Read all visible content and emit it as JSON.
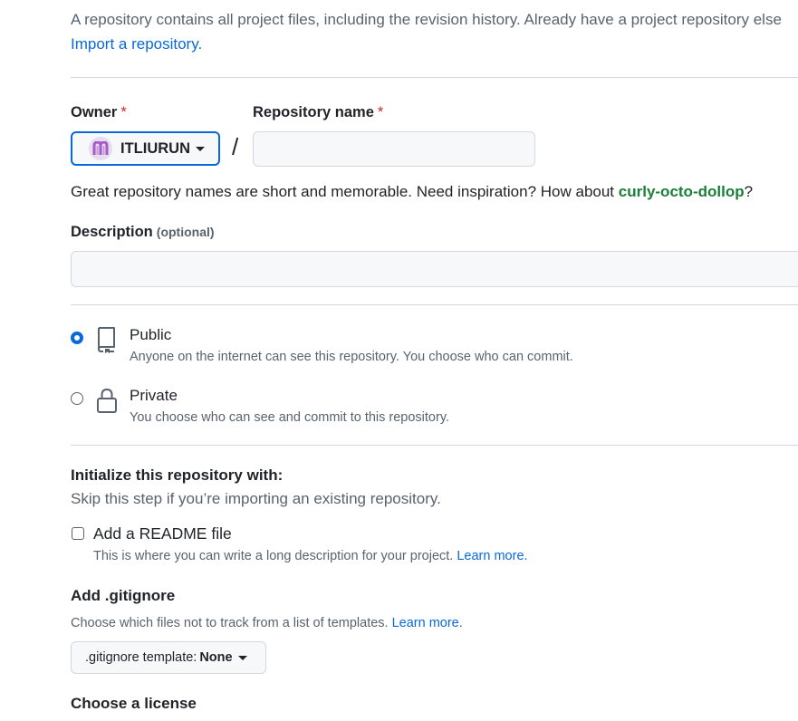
{
  "intro": {
    "text": "A repository contains all project files, including the revision history. Already have a project repository else",
    "import_link": "Import a repository."
  },
  "owner": {
    "label": "Owner",
    "required_mark": "*",
    "value": "ITLIURUN"
  },
  "repo_name": {
    "label": "Repository name",
    "required_mark": "*",
    "value": "",
    "placeholder": ""
  },
  "separator": "/",
  "name_hint": {
    "text": "Great repository names are short and memorable. Need inspiration? How about ",
    "suggestion": "curly-octo-dollop",
    "suffix": "?"
  },
  "description": {
    "label": "Description",
    "optional": "(optional)",
    "value": "",
    "placeholder": ""
  },
  "visibility": {
    "options": [
      {
        "title": "Public",
        "desc": "Anyone on the internet can see this repository. You choose who can commit.",
        "checked": true
      },
      {
        "title": "Private",
        "desc": "You choose who can see and commit to this repository.",
        "checked": false
      }
    ]
  },
  "initialize": {
    "title": "Initialize this repository with:",
    "subtitle": "Skip this step if you’re importing an existing repository.",
    "readme_label": "Add a README file",
    "readme_checked": false,
    "readme_desc": "This is where you can write a long description for your project. ",
    "readme_link": "Learn more."
  },
  "gitignore": {
    "title": "Add .gitignore",
    "desc": "Choose which files not to track from a list of templates. ",
    "link": "Learn more.",
    "select_prefix": ".gitignore template: ",
    "select_value": "None"
  },
  "license": {
    "title": "Choose a license"
  },
  "colors": {
    "accent": "#0969da",
    "suggest": "#1a7f37",
    "required": "#d1242f"
  }
}
